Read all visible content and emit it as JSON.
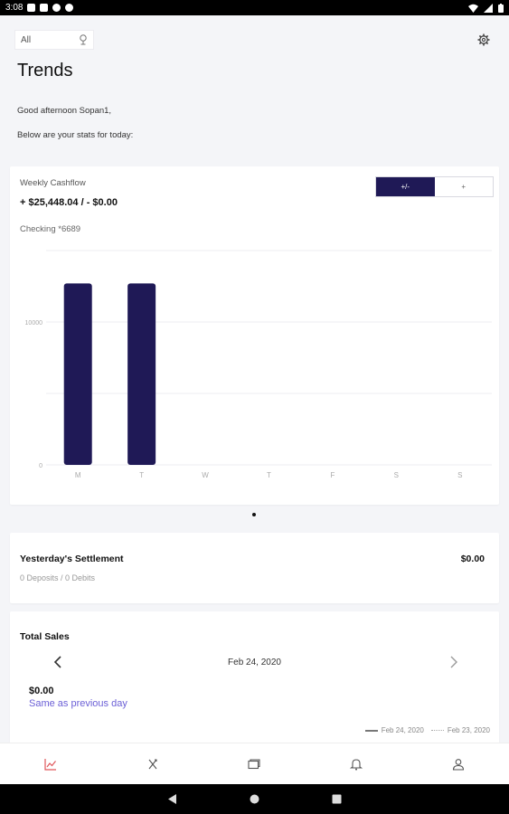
{
  "status_bar": {
    "time": "3:08"
  },
  "header": {
    "filter": {
      "value": "All"
    },
    "title": "Trends",
    "greeting": "Good afternoon Sopan1,",
    "subtitle": "Below are your stats for today:"
  },
  "cashflow": {
    "title": "Weekly Cashflow",
    "amount": "+ $25,448.04 / - $0.00",
    "account": "Checking *6689",
    "toggle": [
      "+/-",
      "+"
    ],
    "colors": {
      "bar": "#1f1956",
      "grid": "#ececf0",
      "tick": "#aaaaaa"
    }
  },
  "chart_data": {
    "type": "bar",
    "categories": [
      "M",
      "T",
      "W",
      "T",
      "F",
      "S",
      "S"
    ],
    "values": [
      12700,
      12700,
      0,
      0,
      0,
      0,
      0
    ],
    "ylim": [
      0,
      15000
    ],
    "yticks": [
      0,
      10000
    ],
    "ytick_labels": [
      "0",
      "10000"
    ],
    "gridlines": [
      0,
      5000,
      10000,
      15000
    ],
    "grid": true
  },
  "settlement": {
    "title": "Yesterday's Settlement",
    "amount": "$0.00",
    "summary": "0 Deposits / 0 Debits"
  },
  "sales": {
    "title": "Total Sales",
    "date": "Feb 24, 2020",
    "amount": "$0.00",
    "comparison": "Same as previous day",
    "legend": [
      "Feb 24, 2020",
      "Feb 23, 2020"
    ]
  },
  "nav": {
    "items": [
      "trends-icon",
      "transfer-icon",
      "cards-icon",
      "bell-icon",
      "profile-icon"
    ],
    "active_color": "#e0565b"
  }
}
